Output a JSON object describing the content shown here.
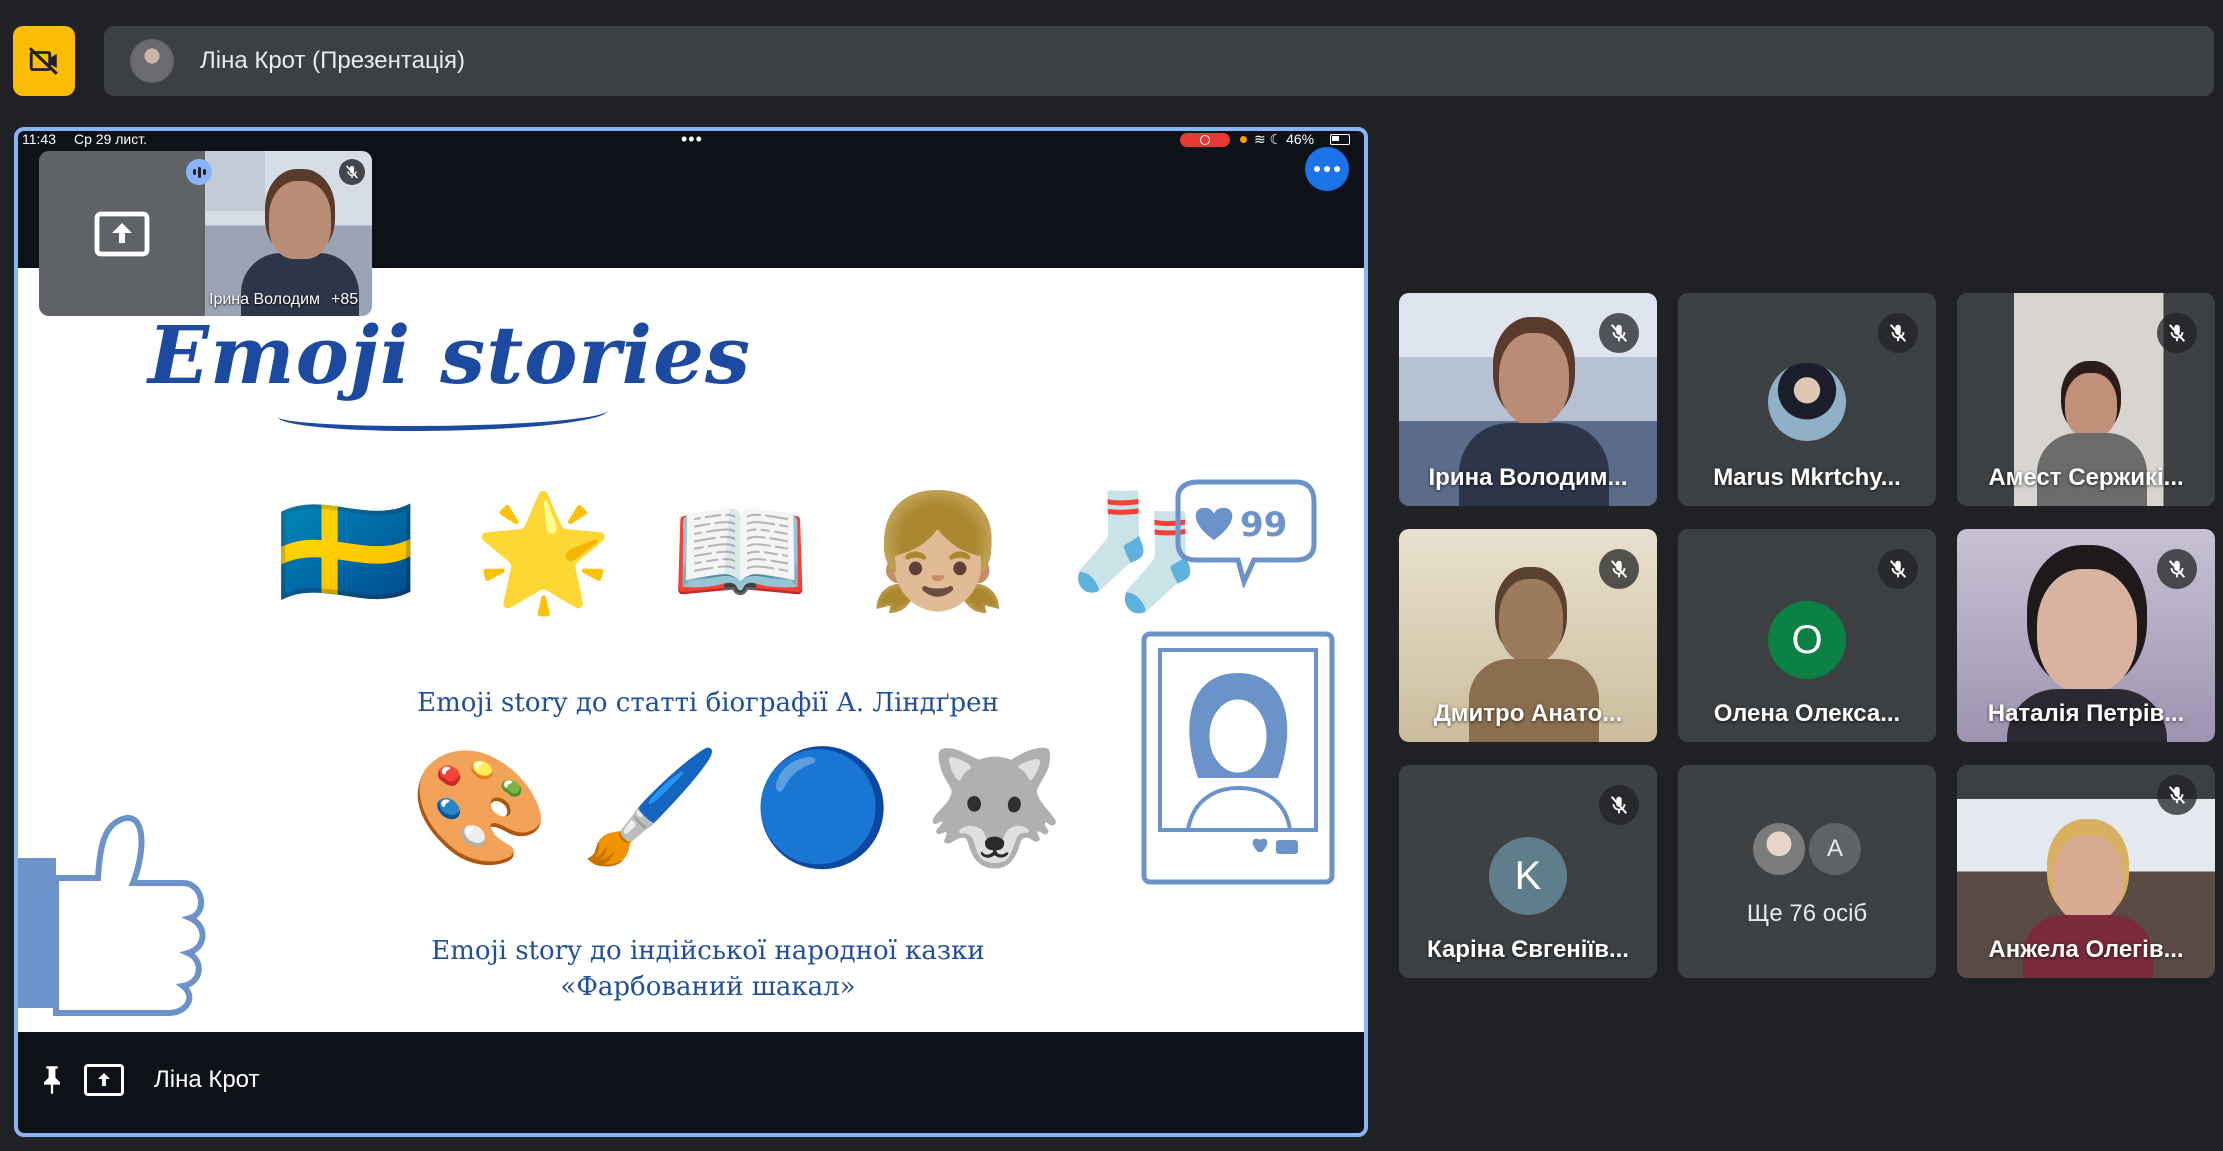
{
  "presenter_bar": {
    "name": "Ліна Крот (Презентація)"
  },
  "device_status": {
    "time": "11:43",
    "date": "Ср 29 лист.",
    "battery": "46%"
  },
  "self_view": {
    "participant_label": "Ірина Володим",
    "others_count": "+85"
  },
  "slide": {
    "title": "Emoji stories",
    "row1_emojis": [
      "🇸🇪",
      "🌟",
      "📖",
      "👧🏼",
      "🧦"
    ],
    "caption1": "Emoji story до статті біографії А. Ліндґрен",
    "row2_emojis": [
      "🎨",
      "🖌️",
      "🔵",
      "🐺"
    ],
    "caption2_line1": "Emoji story до індійської народної казки",
    "caption2_line2": "«Фарбований шакал»",
    "bubble_count": "99"
  },
  "footer": {
    "presenter_name": "Ліна Крот"
  },
  "participants": [
    {
      "name": "Ірина Володим...",
      "type": "video"
    },
    {
      "name": "Marus Mkrtchy...",
      "type": "photo"
    },
    {
      "name": "Амест Сержикі...",
      "type": "video"
    },
    {
      "name": "Дмитро Анато...",
      "type": "video"
    },
    {
      "name": "Олена Олекса...",
      "type": "letter",
      "letter": "О",
      "color": "#0b8043"
    },
    {
      "name": "Наталія Петрів...",
      "type": "video"
    },
    {
      "name": "Каріна Євгеніїв...",
      "type": "letter",
      "letter": "K",
      "color": "#5f7d8b"
    },
    {
      "name": "Ще 76 осіб",
      "type": "more",
      "letter": "A"
    },
    {
      "name": "Анжела Олегів...",
      "type": "video"
    }
  ],
  "colors": {
    "accent": "#8ab4f8",
    "warning": "#fbbc04",
    "slide_blue": "#1b4aa0"
  }
}
